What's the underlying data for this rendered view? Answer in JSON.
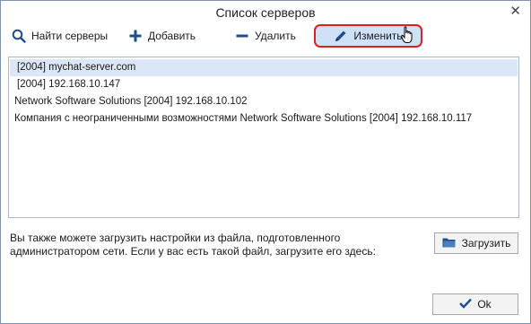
{
  "window": {
    "title": "Список серверов",
    "close_glyph": "✕"
  },
  "toolbar": {
    "find_label": "Найти серверы",
    "add_label": "Добавить",
    "remove_label": "Удалить",
    "edit_label": "Изменить"
  },
  "servers": [
    "[2004] mychat-server.com",
    "[2004] 192.168.10.147",
    "Network Software Solutions [2004] 192.168.10.102",
    "Компания с неограниченными возможностями Network Software Solutions [2004] 192.168.10.117"
  ],
  "info": {
    "line1": "Вы также можете загрузить настройки из файла, подготовленного",
    "line2": "администратором сети. Если у вас есть такой файл, загрузите его здесь:"
  },
  "buttons": {
    "load_label": "Загрузить",
    "ok_label": "Ok"
  },
  "icons": {
    "find": "magnifier-icon",
    "add": "plus-icon",
    "remove": "minus-icon",
    "edit": "pencil-icon",
    "load": "folder-icon",
    "ok": "checkmark-icon"
  },
  "colors": {
    "accent": "#1f4e8c",
    "selection": "#dbe6f7",
    "highlight_border": "#e0201a"
  }
}
